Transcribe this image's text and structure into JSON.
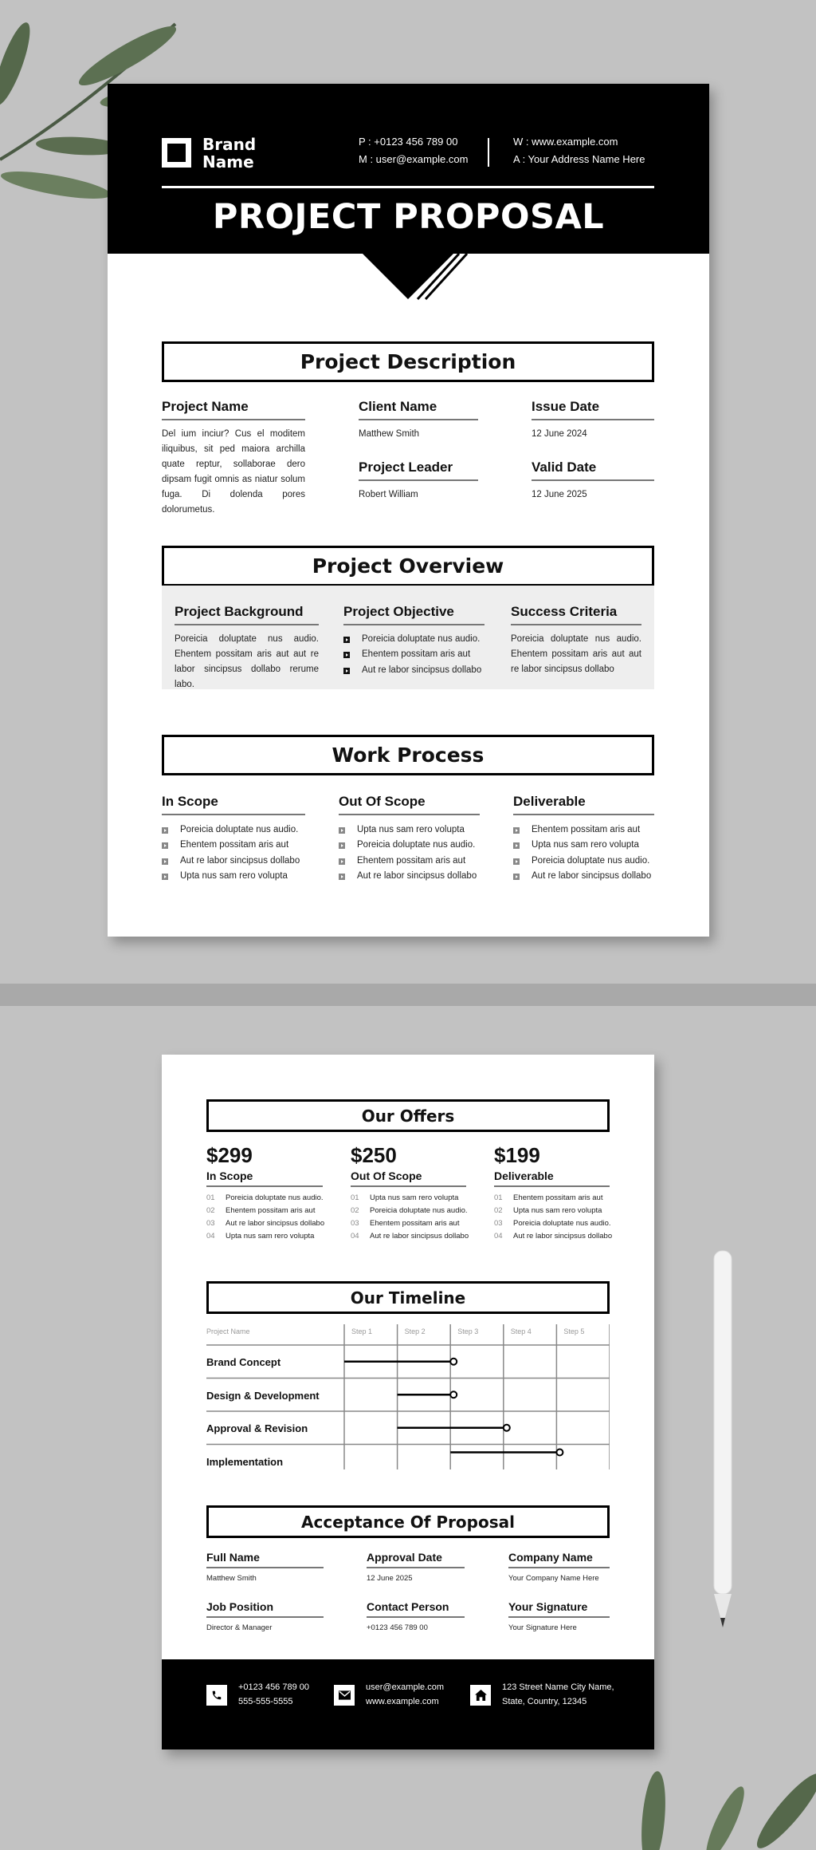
{
  "header": {
    "brand_line1": "Brand",
    "brand_line2": "Name",
    "phone": "P : +0123 456 789 00",
    "email": "M : user@example.com",
    "web": "W : www.example.com",
    "address": "A : Your Address Name Here",
    "title": "PROJECT PROPOSAL"
  },
  "description": {
    "title": "Project Description",
    "project_name": {
      "label": "Project Name",
      "text": "Del ium inciur? Cus el moditem iliquibus, sit ped maiora archilla quate reptur, sollaborae dero dipsam fugit omnis as niatur solum fuga. Di dolenda pores dolorumetus."
    },
    "client_name": {
      "label": "Client Name",
      "value": "Matthew Smith"
    },
    "issue_date": {
      "label": "Issue Date",
      "value": "12 June 2024"
    },
    "project_leader": {
      "label": "Project Leader",
      "value": "Robert William"
    },
    "valid_date": {
      "label": "Valid Date",
      "value": "12 June 2025"
    }
  },
  "overview": {
    "title": "Project Overview",
    "background": {
      "label": "Project Background",
      "text": "Poreicia doluptate nus audio. Ehentem possitam aris aut aut re labor sincipsus dollabo rerume labo."
    },
    "objective": {
      "label": "Project Objective",
      "items": [
        "Poreicia doluptate nus audio.",
        "Ehentem possitam aris aut",
        "Aut re labor sincipsus dollabo"
      ]
    },
    "success": {
      "label": "Success Criteria",
      "text": "Poreicia doluptate nus audio. Ehentem possitam aris aut aut re labor sincipsus dollabo"
    }
  },
  "work": {
    "title": "Work Process",
    "columns": [
      {
        "label": "In Scope",
        "items": [
          "Poreicia doluptate nus audio.",
          "Ehentem possitam aris aut",
          "Aut re labor sincipsus dollabo",
          "Upta nus sam rero volupta"
        ]
      },
      {
        "label": "Out Of Scope",
        "items": [
          "Upta nus sam rero volupta",
          "Poreicia doluptate nus audio.",
          "Ehentem possitam aris aut",
          "Aut re labor sincipsus dollabo"
        ]
      },
      {
        "label": "Deliverable",
        "items": [
          "Ehentem possitam aris aut",
          "Upta nus sam rero volupta",
          "Poreicia doluptate nus audio.",
          "Aut re labor sincipsus dollabo"
        ]
      }
    ]
  },
  "offers": {
    "title": "Our Offers",
    "columns": [
      {
        "price": "$299",
        "label": "In Scope",
        "items": [
          {
            "n": "01",
            "t": "Poreicia doluptate nus audio."
          },
          {
            "n": "02",
            "t": "Ehentem possitam aris aut"
          },
          {
            "n": "03",
            "t": "Aut re labor sincipsus dollabo"
          },
          {
            "n": "04",
            "t": "Upta nus sam rero volupta"
          }
        ]
      },
      {
        "price": "$250",
        "label": "Out Of Scope",
        "items": [
          {
            "n": "01",
            "t": "Upta nus sam rero volupta"
          },
          {
            "n": "02",
            "t": "Poreicia doluptate nus audio."
          },
          {
            "n": "03",
            "t": "Ehentem possitam aris aut"
          },
          {
            "n": "04",
            "t": "Aut re labor sincipsus dollabo"
          }
        ]
      },
      {
        "price": "$199",
        "label": "Deliverable",
        "items": [
          {
            "n": "01",
            "t": "Ehentem possitam aris aut"
          },
          {
            "n": "02",
            "t": "Upta nus sam rero volupta"
          },
          {
            "n": "03",
            "t": "Poreicia doluptate nus audio."
          },
          {
            "n": "04",
            "t": "Aut re labor sincipsus dollabo"
          }
        ]
      }
    ]
  },
  "timeline": {
    "title": "Our Timeline",
    "header": "Project Name",
    "steps": [
      "Step 1",
      "Step 2",
      "Step 3",
      "Step 4",
      "Step 5"
    ],
    "rows": [
      {
        "name": "Brand Concept",
        "start_step": 1,
        "end_step": 3
      },
      {
        "name": "Design & Development",
        "start_step": 2,
        "end_step": 3
      },
      {
        "name": "Approval & Revision",
        "start_step": 2,
        "end_step": 4
      },
      {
        "name": "Implementation",
        "start_step": 3,
        "end_step": 5
      }
    ]
  },
  "acceptance": {
    "title": "Acceptance Of Proposal",
    "fields": [
      {
        "label": "Full Name",
        "value": "Matthew Smith"
      },
      {
        "label": "Approval Date",
        "value": "12 June 2025"
      },
      {
        "label": "Company Name",
        "value": "Your Company Name Here"
      },
      {
        "label": "Job Position",
        "value": "Director & Manager"
      },
      {
        "label": "Contact Person",
        "value": "+0123 456 789 00"
      },
      {
        "label": "Your Signature",
        "value": "Your Signature Here"
      }
    ]
  },
  "footer": {
    "phone1": "+0123 456 789 00",
    "phone2": "555-555-5555",
    "email": "user@example.com",
    "web": "www.example.com",
    "address1": "123 Street Name City Name,",
    "address2": "State, Country, 12345",
    "icons": [
      "phone-icon",
      "envelope-icon",
      "home-icon"
    ]
  }
}
